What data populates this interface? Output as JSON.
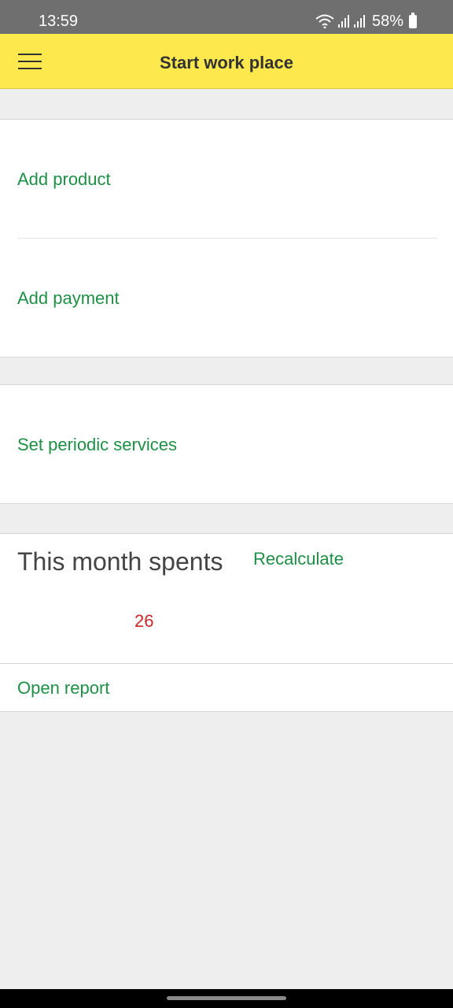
{
  "status_bar": {
    "time": "13:59",
    "battery": "58%",
    "icons": [
      "wifi-icon",
      "signal-icon",
      "signal-icon",
      "battery-icon"
    ]
  },
  "toolbar": {
    "title": "Start work place",
    "menu_icon": "hamburger-menu-icon",
    "background": "#fde84e"
  },
  "actions": {
    "add_product": "Add product",
    "add_payment": "Add payment",
    "set_periodic_services": "Set periodic services"
  },
  "spents": {
    "title": "This month spents",
    "recalculate": "Recalculate",
    "amount": "26",
    "open_report": "Open report"
  },
  "colors": {
    "link": "#1e9046",
    "amount": "#c62828"
  }
}
